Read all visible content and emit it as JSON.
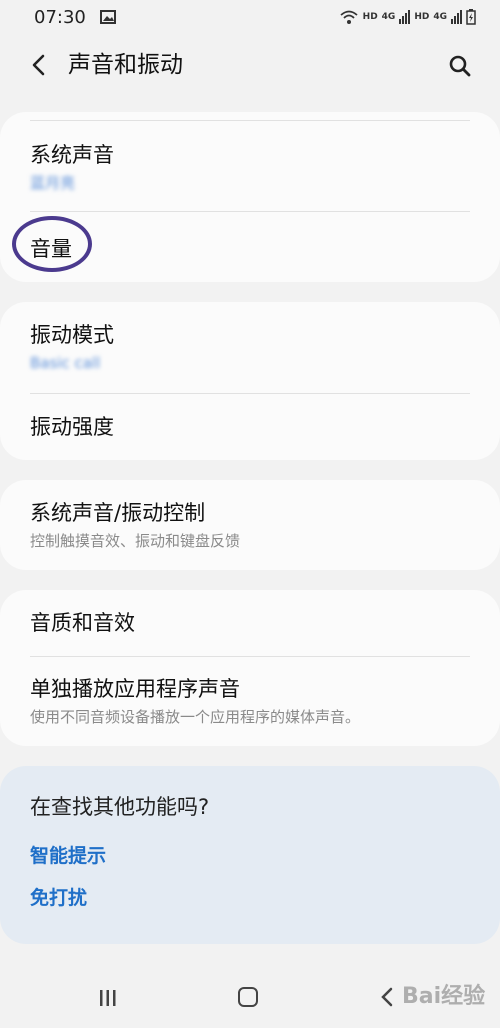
{
  "status_bar": {
    "time": "07:30",
    "net1": "HD",
    "net1_gen": "4G",
    "net2": "HD",
    "net2_gen": "4G"
  },
  "header": {
    "title": "声音和振动"
  },
  "groups": {
    "g1": {
      "system_sound_title": "系统声音",
      "system_sound_sub": "蓝月亮",
      "volume_title": "音量"
    },
    "g2": {
      "vibration_pattern_title": "振动模式",
      "vibration_pattern_sub": "Basic call",
      "vibration_intensity_title": "振动强度"
    },
    "g3": {
      "control_title": "系统声音/振动控制",
      "control_sub": "控制触摸音效、振动和键盘反馈"
    },
    "g4": {
      "quality_title": "音质和音效",
      "separate_title": "单独播放应用程序声音",
      "separate_sub": "使用不同音频设备播放一个应用程序的媒体声音。"
    }
  },
  "suggest": {
    "title": "在查找其他功能吗?",
    "link1": "智能提示",
    "link2": "免打扰"
  },
  "watermark": "Bai经验"
}
